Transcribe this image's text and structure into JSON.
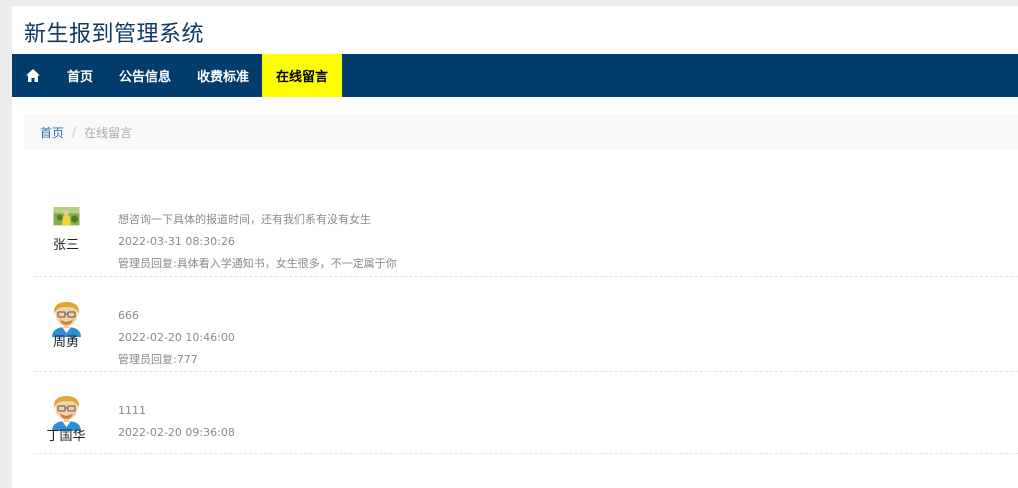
{
  "site": {
    "title": "新生报到管理系统"
  },
  "nav": {
    "home_icon": "home-icon",
    "items": [
      "首页",
      "公告信息",
      "收费标准",
      "在线留言"
    ],
    "active_index": 3,
    "active_color": "#ffff00",
    "bar_color": "#003c6c"
  },
  "breadcrumb": {
    "home": "首页",
    "separator": "/",
    "current": "在线留言"
  },
  "messages": [
    {
      "user": "张三",
      "avatar": "photo-avatar",
      "content": "想咨询一下具体的报道时间，还有我们系有没有女生",
      "time": "2022-03-31 08:30:26",
      "reply": "管理员回复:具体看入学通知书，女生很多，不一定属于你"
    },
    {
      "user": "周勇",
      "avatar": "cartoon-avatar",
      "content": "666",
      "time": "2022-02-20 10:46:00",
      "reply": "管理员回复:777"
    },
    {
      "user": "丁国华",
      "avatar": "cartoon-avatar",
      "content": "1111",
      "time": "2022-02-20 09:36:08",
      "reply": ""
    }
  ]
}
